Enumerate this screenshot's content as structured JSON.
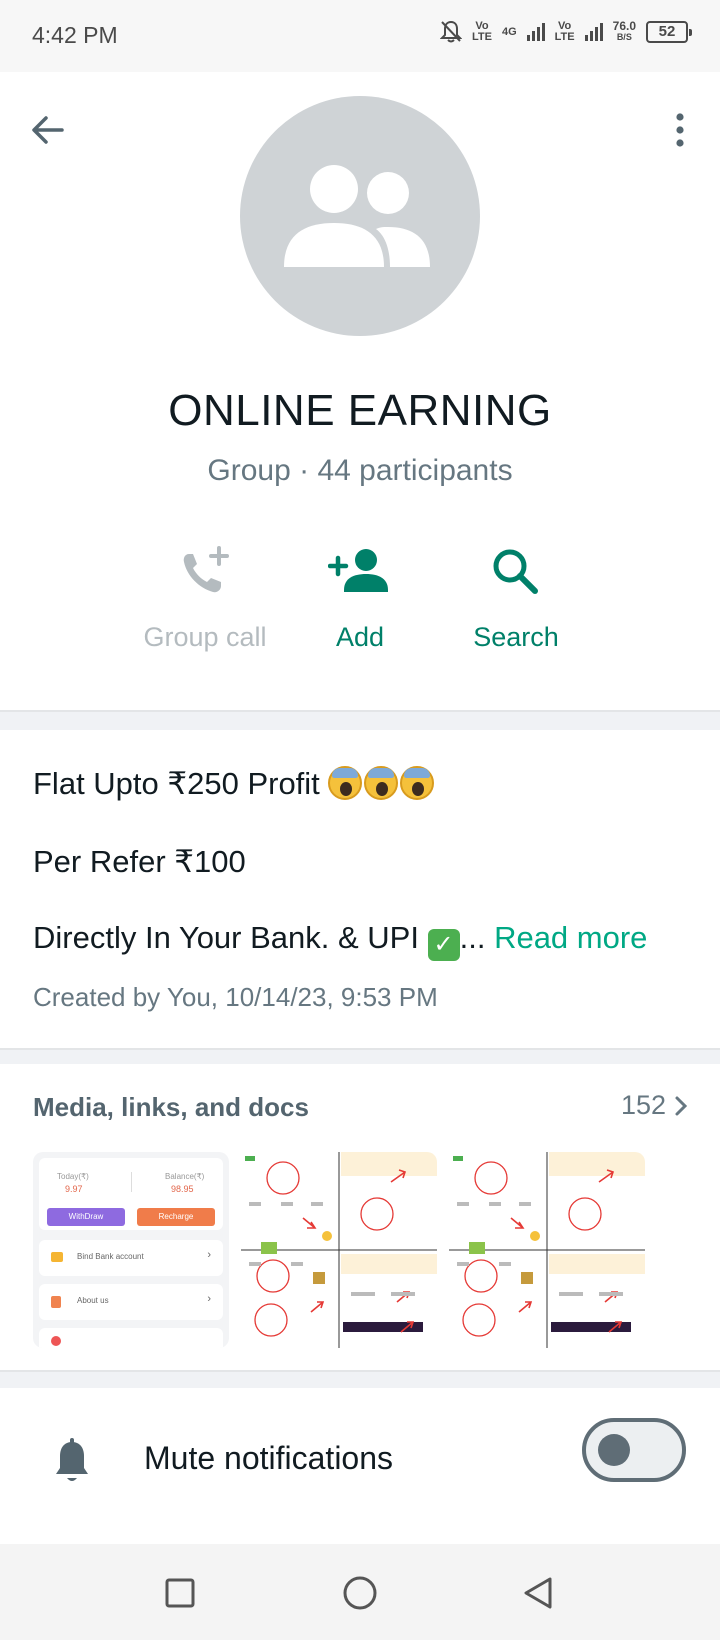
{
  "status_bar": {
    "time": "4:42 PM",
    "network1": "Vo LTE",
    "network_type": "4G",
    "network2": "Vo LTE",
    "speed_value": "76.0",
    "speed_unit": "B/S",
    "battery": "52"
  },
  "header": {
    "group_name": "ONLINE EARNING",
    "subtitle": "Group · 44 participants",
    "actions": [
      {
        "label": "Group call",
        "icon": "phone-add-icon",
        "enabled": false
      },
      {
        "label": "Add",
        "icon": "person-add-icon",
        "enabled": true
      },
      {
        "label": "Search",
        "icon": "search-icon",
        "enabled": true
      }
    ]
  },
  "description": {
    "line1": "Flat Upto ₹250 Profit",
    "line2": "Per Refer ₹100",
    "line3": "Directly In Your Bank. & UPI",
    "ellipsis": "...",
    "read_more": "Read more",
    "created": "Created by You, 10/14/23, 9:53 PM"
  },
  "media": {
    "title": "Media, links, and docs",
    "count": "152",
    "thumb1": {
      "today_label": "Today(₹)",
      "today_value": "9.97",
      "balance_label": "Balance(₹)",
      "balance_value": "98.95",
      "withdraw": "WithDraw",
      "recharge": "Recharge",
      "row1": "Bind Bank account",
      "row2": "About us"
    }
  },
  "mute": {
    "label": "Mute notifications",
    "enabled": false
  },
  "colors": {
    "accent": "#008069",
    "disabled": "#b4bbbf",
    "avatar_bg": "#cfd3d6"
  }
}
